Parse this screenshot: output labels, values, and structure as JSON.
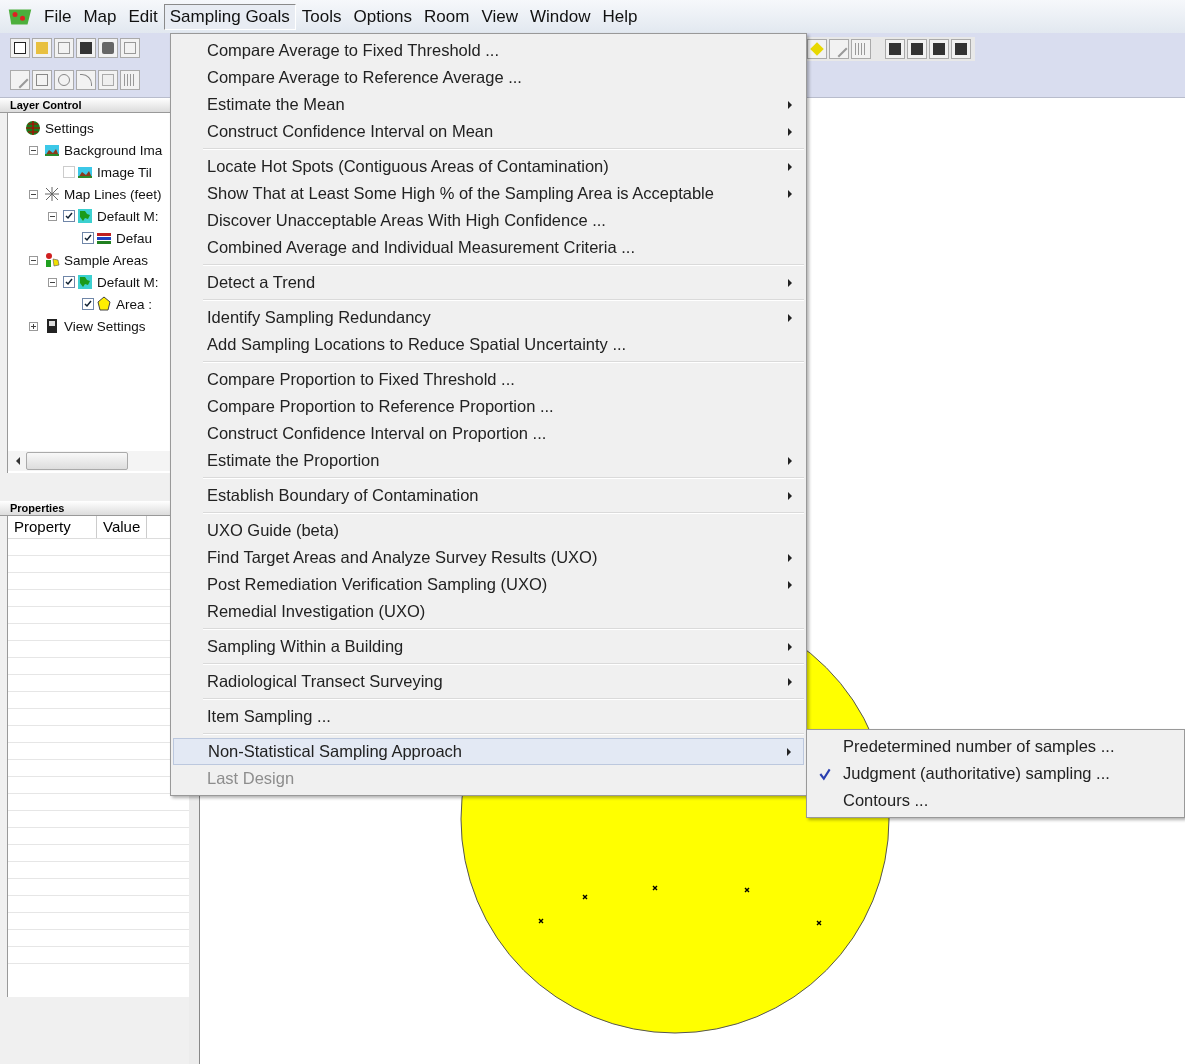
{
  "menubar": [
    {
      "label": "File",
      "selected": false
    },
    {
      "label": "Map",
      "selected": false
    },
    {
      "label": "Edit",
      "selected": false
    },
    {
      "label": "Sampling Goals",
      "selected": true
    },
    {
      "label": "Tools",
      "selected": false
    },
    {
      "label": "Options",
      "selected": false
    },
    {
      "label": "Room",
      "selected": false
    },
    {
      "label": "View",
      "selected": false
    },
    {
      "label": "Window",
      "selected": false
    },
    {
      "label": "Help",
      "selected": false
    }
  ],
  "layer_control": {
    "title": "Layer Control",
    "tree": [
      {
        "label": "Settings",
        "kind": "settings",
        "children": [
          {
            "label": "Background Ima",
            "kind": "image",
            "expanded": true,
            "children": [
              {
                "label": "Image Til",
                "kind": "image",
                "checked": false
              }
            ]
          },
          {
            "label": "Map Lines (feet)",
            "kind": "lines",
            "expanded": true,
            "children": [
              {
                "label": "Default M:",
                "kind": "map",
                "checked": true,
                "expanded": true,
                "children": [
                  {
                    "label": "Defau",
                    "kind": "layer",
                    "checked": true
                  }
                ]
              }
            ]
          },
          {
            "label": "Sample Areas",
            "kind": "areas",
            "expanded": true,
            "children": [
              {
                "label": "Default M:",
                "kind": "map",
                "checked": true,
                "expanded": true,
                "children": [
                  {
                    "label": "Area :",
                    "kind": "polygon",
                    "checked": true
                  }
                ]
              }
            ]
          },
          {
            "label": "View Settings",
            "kind": "view",
            "expanded": false
          }
        ]
      }
    ]
  },
  "properties": {
    "title": "Properties",
    "columns": [
      "Property",
      "Value"
    ]
  },
  "menu": {
    "groups": [
      [
        {
          "label": "Compare Average to Fixed Threshold ...",
          "has_submenu": false,
          "selected": false,
          "disabled": false
        },
        {
          "label": "Compare Average to Reference Average ...",
          "has_submenu": false,
          "selected": false,
          "disabled": false
        },
        {
          "label": "Estimate the Mean",
          "has_submenu": true,
          "selected": false,
          "disabled": false
        },
        {
          "label": "Construct Confidence Interval on Mean",
          "has_submenu": true,
          "selected": false,
          "disabled": false
        }
      ],
      [
        {
          "label": "Locate Hot Spots (Contiguous Areas of Contamination)",
          "has_submenu": true,
          "selected": false,
          "disabled": false
        },
        {
          "label": "Show That at Least Some High % of the Sampling Area is Acceptable",
          "has_submenu": true,
          "selected": false,
          "disabled": false
        },
        {
          "label": "Discover Unacceptable Areas With High Confidence ...",
          "has_submenu": false,
          "selected": false,
          "disabled": false
        },
        {
          "label": "Combined Average and Individual Measurement Criteria ...",
          "has_submenu": false,
          "selected": false,
          "disabled": false
        }
      ],
      [
        {
          "label": "Detect a Trend",
          "has_submenu": true,
          "selected": false,
          "disabled": false
        }
      ],
      [
        {
          "label": "Identify Sampling Redundancy",
          "has_submenu": true,
          "selected": false,
          "disabled": false
        },
        {
          "label": "Add Sampling Locations to Reduce Spatial Uncertainty ...",
          "has_submenu": false,
          "selected": false,
          "disabled": false
        }
      ],
      [
        {
          "label": "Compare Proportion to Fixed Threshold ...",
          "has_submenu": false,
          "selected": false,
          "disabled": false
        },
        {
          "label": "Compare Proportion to Reference Proportion ...",
          "has_submenu": false,
          "selected": false,
          "disabled": false
        },
        {
          "label": "Construct Confidence Interval on Proportion ...",
          "has_submenu": false,
          "selected": false,
          "disabled": false
        },
        {
          "label": "Estimate the Proportion",
          "has_submenu": true,
          "selected": false,
          "disabled": false
        }
      ],
      [
        {
          "label": "Establish Boundary of Contamination",
          "has_submenu": true,
          "selected": false,
          "disabled": false
        }
      ],
      [
        {
          "label": "UXO Guide (beta)",
          "has_submenu": false,
          "selected": false,
          "disabled": false
        },
        {
          "label": "Find Target Areas and Analyze Survey Results (UXO)",
          "has_submenu": true,
          "selected": false,
          "disabled": false
        },
        {
          "label": "Post Remediation Verification Sampling (UXO)",
          "has_submenu": true,
          "selected": false,
          "disabled": false
        },
        {
          "label": "Remedial Investigation (UXO)",
          "has_submenu": false,
          "selected": false,
          "disabled": false
        }
      ],
      [
        {
          "label": "Sampling Within a Building",
          "has_submenu": true,
          "selected": false,
          "disabled": false
        }
      ],
      [
        {
          "label": "Radiological Transect Surveying",
          "has_submenu": true,
          "selected": false,
          "disabled": false
        }
      ],
      [
        {
          "label": "Item Sampling ...",
          "has_submenu": false,
          "selected": false,
          "disabled": false
        }
      ],
      [
        {
          "label": "Non-Statistical Sampling Approach",
          "has_submenu": true,
          "selected": true,
          "disabled": false
        },
        {
          "label": "Last Design",
          "has_submenu": false,
          "selected": false,
          "disabled": true
        }
      ]
    ]
  },
  "submenu": {
    "items": [
      {
        "label": "Predetermined number of samples ...",
        "checked": false
      },
      {
        "label": "Judgment (authoritative) sampling ...",
        "checked": true
      },
      {
        "label": "Contours ...",
        "checked": false
      }
    ]
  }
}
